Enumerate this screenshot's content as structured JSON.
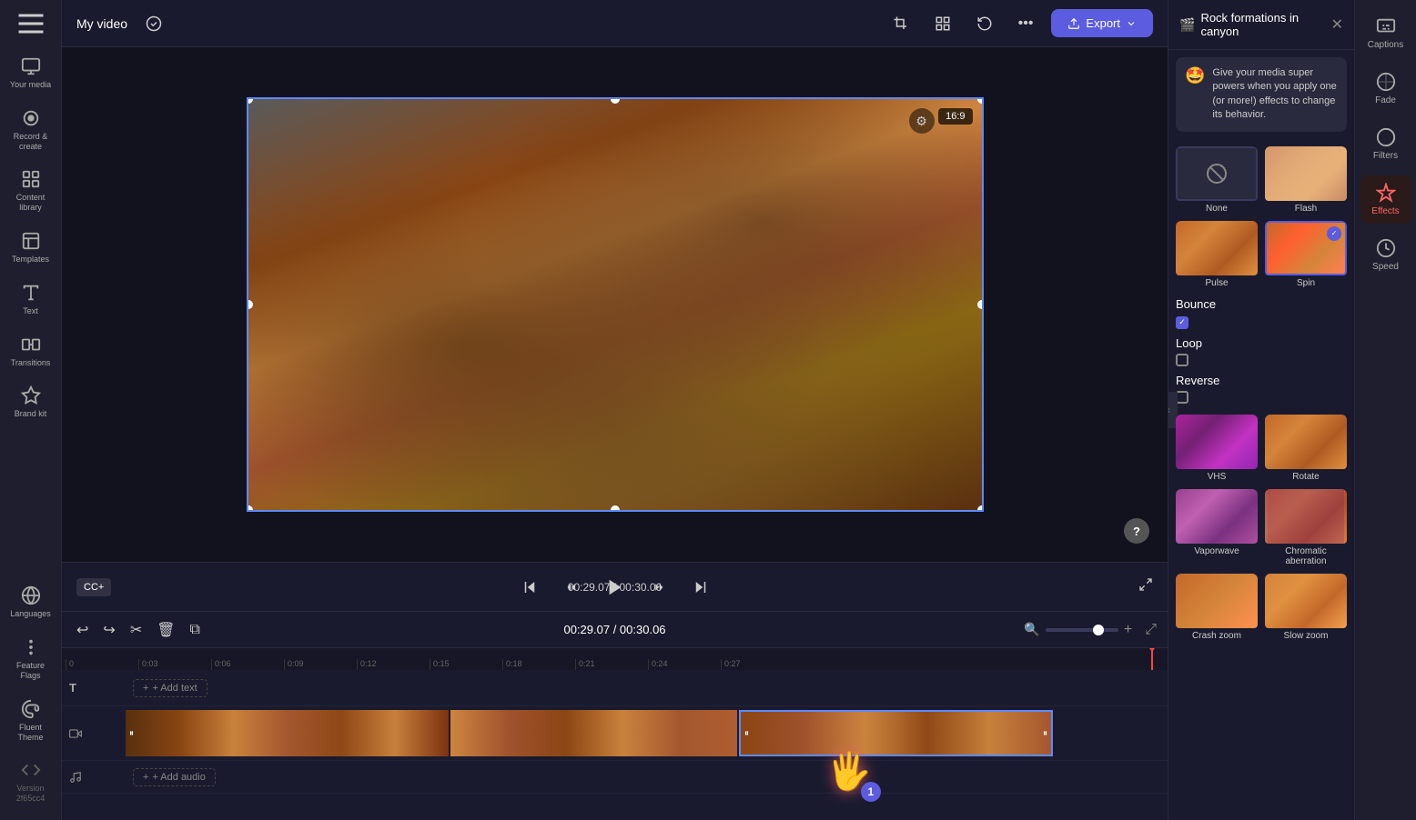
{
  "app": {
    "title": "My video",
    "export_label": "Export"
  },
  "sidebar": {
    "items": [
      {
        "label": "Your media",
        "icon": "film-icon"
      },
      {
        "label": "Record &\ncreate",
        "icon": "record-icon"
      },
      {
        "label": "Content library",
        "icon": "library-icon"
      },
      {
        "label": "Templates",
        "icon": "templates-icon"
      },
      {
        "label": "Text",
        "icon": "text-icon"
      },
      {
        "label": "Transitions",
        "icon": "transitions-icon"
      },
      {
        "label": "Brand kit",
        "icon": "brand-icon"
      }
    ]
  },
  "canvas": {
    "aspect_ratio": "16:9"
  },
  "player": {
    "time_current": "00:29.07",
    "time_total": "00:30.06",
    "cc_label": "CC+"
  },
  "right_panel": {
    "title": "Rock formations in canyon",
    "tooltip": "Give your media super powers when you apply one (or more!) effects to change its behavior.",
    "tooltip_emoji": "🤩",
    "effects": [
      {
        "id": "none",
        "label": "None",
        "selected": false
      },
      {
        "id": "flash",
        "label": "Flash",
        "selected": false
      },
      {
        "id": "pulse",
        "label": "Pulse",
        "selected": false
      },
      {
        "id": "spin",
        "label": "Spin",
        "selected": true
      }
    ],
    "bounce": {
      "label": "Bounce",
      "checked": true
    },
    "loop": {
      "label": "Loop",
      "checked": false
    },
    "reverse": {
      "label": "Reverse",
      "checked": false
    },
    "more_effects": [
      {
        "id": "vhs",
        "label": "VHS"
      },
      {
        "id": "rotate",
        "label": "Rotate"
      },
      {
        "id": "vaporwave",
        "label": "Vaporwave"
      },
      {
        "id": "chromatic",
        "label": "Chromatic aberration"
      },
      {
        "id": "crash",
        "label": "Crash zoom"
      },
      {
        "id": "slow",
        "label": "Slow zoom"
      }
    ]
  },
  "right_icons": [
    {
      "label": "Captions",
      "icon": "captions-icon"
    },
    {
      "label": "Fade",
      "icon": "fade-icon"
    },
    {
      "label": "Filters",
      "icon": "filters-icon"
    },
    {
      "label": "Effects",
      "icon": "effects-icon",
      "active": true
    },
    {
      "label": "Speed",
      "icon": "speed-icon"
    }
  ],
  "timeline": {
    "current_time": "00:29.07",
    "total_time": "00:30.06",
    "markers": [
      "0",
      "0:03",
      "0:06",
      "0:09",
      "0:12",
      "0:15",
      "0:18",
      "0:21",
      "0:24",
      "0:27"
    ],
    "add_text_label": "+ Add text",
    "add_audio_label": "+ Add audio"
  },
  "sidebar_bottom": [
    {
      "label": "Languages",
      "icon": "languages-icon"
    },
    {
      "label": "Feature Flags",
      "icon": "feature-icon"
    },
    {
      "label": "Fluent Theme",
      "icon": "theme-icon"
    },
    {
      "label": "Version 2f65cc4",
      "icon": "version-icon"
    }
  ]
}
